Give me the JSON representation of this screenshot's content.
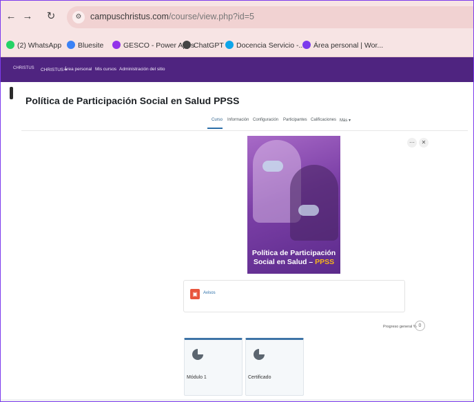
{
  "browser": {
    "url_host": "campuschristus.com",
    "url_path": "/course/view.php?id=5",
    "bookmarks": [
      {
        "label": "(2) WhatsApp",
        "icon": "whatsapp-icon",
        "color": "#25d366"
      },
      {
        "label": "Bluesite",
        "icon": "bluesite-icon",
        "color": "#3b82f6"
      },
      {
        "label": "GESCO - Power Apps",
        "icon": "power-apps-icon",
        "color": "#9333ea"
      },
      {
        "label": "ChatGPT",
        "icon": "chatgpt-icon",
        "color": "#444444"
      },
      {
        "label": "Docencia Servicio -...",
        "icon": "cloud-icon",
        "color": "#0ea5e9"
      },
      {
        "label": "Área personal | Wor...",
        "icon": "moodle-icon",
        "color": "#7c3aed"
      }
    ]
  },
  "site_nav": {
    "logo": "CHRISTUS",
    "items": [
      "CHRISTUS ▾",
      "Área personal",
      "Mis cursos",
      "Administración del sitio"
    ]
  },
  "course": {
    "title": "Política de Participación Social en Salud PPSS",
    "tabs": [
      "Curso",
      "Información",
      "Configuración",
      "Participantes",
      "Calificaciones",
      "Más ▾"
    ],
    "image_title_line1": "Política de Participación",
    "image_title_line2": "Social en Salud –",
    "image_title_accent": "PPSS",
    "activity_name": "Avisos",
    "progress_label": "Progreso general %",
    "progress_value": "0",
    "sections": [
      "Módulo 1",
      "Certificado"
    ]
  },
  "colors": {
    "navbar": "#4f2480",
    "accent": "#2a6ea8",
    "forum_icon": "#e8553d"
  }
}
